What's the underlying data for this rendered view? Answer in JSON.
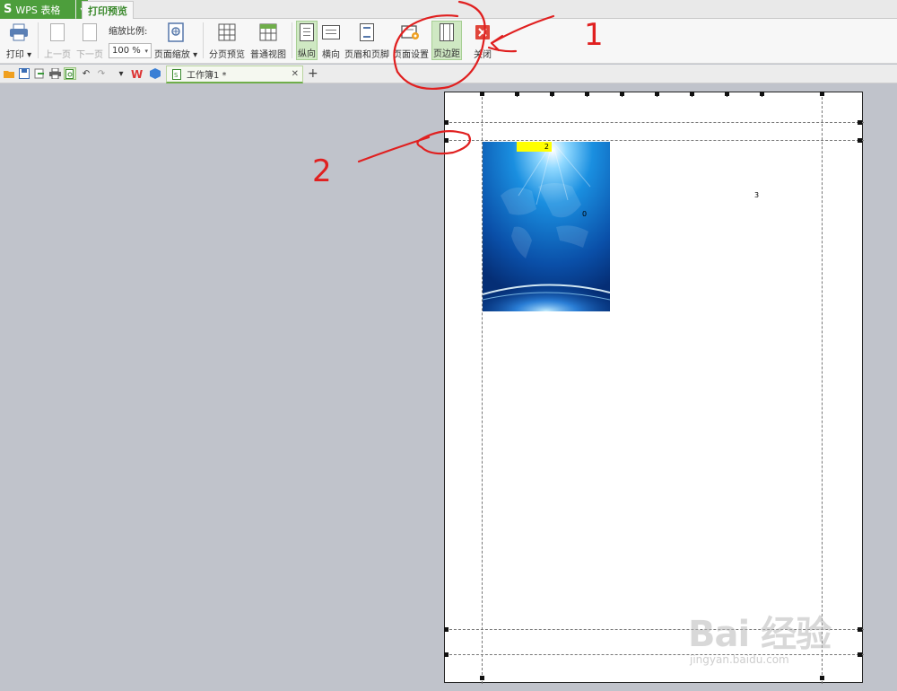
{
  "app": {
    "title": "WPS 表格",
    "logo": "S"
  },
  "ribbon_tab": "打印预览",
  "ribbon": {
    "print": "打印",
    "prev_page": "上一页",
    "next_page": "下一页",
    "zoom_label": "缩放比例:",
    "zoom_value": "100 %",
    "page_zoom": "页面缩放",
    "page_break_preview": "分页预览",
    "normal_view": "普通视图",
    "portrait": "纵向",
    "landscape": "横向",
    "header_footer": "页眉和页脚",
    "page_setup": "页面设置",
    "margins": "页边距",
    "close": "关闭"
  },
  "doc_tab": {
    "name": "工作簿1 *"
  },
  "sheet": {
    "cell_2": "2",
    "cell_3": "3",
    "cell_0": "0"
  },
  "annotations": {
    "label_1": "1",
    "label_2": "2"
  },
  "watermark": {
    "brand": "Bai 经验",
    "url": "jingyan.baidu.com"
  },
  "colors": {
    "app_green": "#4d9e3c",
    "annotation_red": "#e02020",
    "highlight_yellow": "#ffff00"
  }
}
